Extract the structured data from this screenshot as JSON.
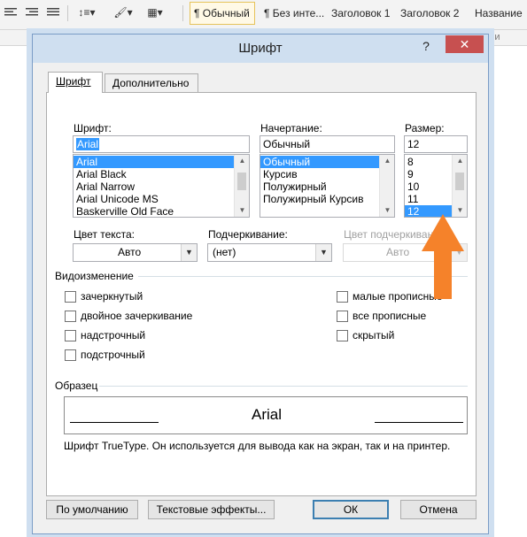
{
  "ribbon": {
    "styles": [
      "¶ Обычный",
      "¶ Без инте...",
      "Заголовок 1",
      "Заголовок 2",
      "Название"
    ],
    "group_label": "ли"
  },
  "dialog": {
    "title": "Шрифт",
    "help": "?",
    "close": "✕",
    "tabs": [
      "Шрифт",
      "Дополнительно"
    ],
    "font": {
      "label": "Шрифт:",
      "value": "Arial",
      "items": [
        "Arial",
        "Arial Black",
        "Arial Narrow",
        "Arial Unicode MS",
        "Baskerville Old Face"
      ],
      "selected": "Arial"
    },
    "style": {
      "label": "Начертание:",
      "value": "Обычный",
      "items": [
        "Обычный",
        "Курсив",
        "Полужирный",
        "Полужирный Курсив"
      ],
      "selected": "Обычный"
    },
    "size": {
      "label": "Размер:",
      "value": "12",
      "items": [
        "8",
        "9",
        "10",
        "11",
        "12"
      ],
      "selected": "12"
    },
    "font_color": {
      "label": "Цвет текста:",
      "value": "Авто"
    },
    "underline": {
      "label": "Подчеркивание:",
      "value": "(нет)"
    },
    "underline_color": {
      "label": "Цвет подчеркивания:",
      "value": "Авто"
    },
    "effects": {
      "label": "Видоизменение",
      "items": [
        "зачеркнутый",
        "двойное зачеркивание",
        "надстрочный",
        "подстрочный",
        "малые прописные",
        "все прописные",
        "скрытый"
      ]
    },
    "preview": {
      "label": "Образец",
      "text": "Arial"
    },
    "note": "Шрифт TrueType. Он используется для вывода как на экран, так и на принтер.",
    "buttons": {
      "default": "По умолчанию",
      "text_effects": "Текстовые эффекты...",
      "ok": "ОК",
      "cancel": "Отмена"
    }
  },
  "annotation": {
    "arrow_color": "#f5822a"
  }
}
